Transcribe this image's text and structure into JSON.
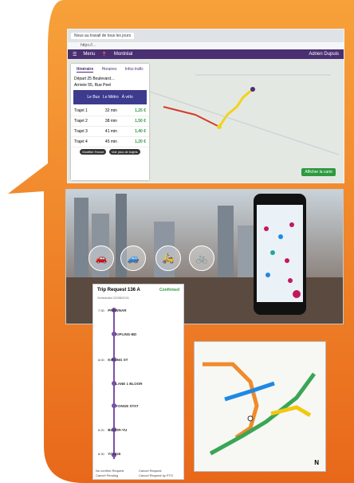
{
  "colors": {
    "bubble_top": "#f7a13a",
    "bubble_bottom": "#e86a1a",
    "brand": "#4a2f72",
    "route_red": "#d63b2a",
    "route_yellow": "#f2d21c"
  },
  "browser": {
    "tab_label": "Nous au travail de tous les jours",
    "url": "https://..."
  },
  "app": {
    "menu_label": "Menu",
    "location_label": "Montréal",
    "user_label": "Adrien Dupuis"
  },
  "planner": {
    "tabs": [
      "Itinéraire",
      "Horaires",
      "Infos trafic"
    ],
    "from": "Départ 25 Boulevard…",
    "to": "Arrivée 55, Rue Peel",
    "modes": [
      "Le Bus",
      "Le Métro",
      "À vélo"
    ],
    "results": [
      {
        "label": "Trajet 1",
        "time": "32 min",
        "price": "1,25 €"
      },
      {
        "label": "Trajet 2",
        "time": "38 min",
        "price": "1,50 €"
      },
      {
        "label": "Trajet 3",
        "time": "41 min",
        "price": "1,40 €"
      },
      {
        "label": "Trajet 4",
        "time": "45 min",
        "price": "1,20 €"
      }
    ],
    "buttons": [
      "Modifier l'heure",
      "Voir plus de trajets"
    ],
    "map_button": "Afficher la carte"
  },
  "trip": {
    "title": "Trip Request 136 A",
    "status": "Confirmed",
    "subtitle": "Scheduled 22/08/2021",
    "stops": [
      {
        "time": "7:30",
        "name": "PREWNAR"
      },
      {
        "time": "",
        "name": "KIPLING-BD"
      },
      {
        "time": "8:00",
        "name": "KIPLING ST"
      },
      {
        "time": "",
        "name": "LANE 1 BLOOR"
      },
      {
        "time": "",
        "name": "YONGE STAT"
      },
      {
        "time": "8:20",
        "name": "BLOOR-YU"
      },
      {
        "time": "8:30",
        "name": "YONGE"
      }
    ],
    "legend": [
      "No confirm Request",
      "Cancel Request",
      "Cancel Pending",
      "Cancel Request by PTO"
    ]
  },
  "metro": {
    "north": "N",
    "lines": [
      "Ligne orange",
      "Ligne verte",
      "Ligne bleue",
      "Ligne jaune"
    ]
  }
}
